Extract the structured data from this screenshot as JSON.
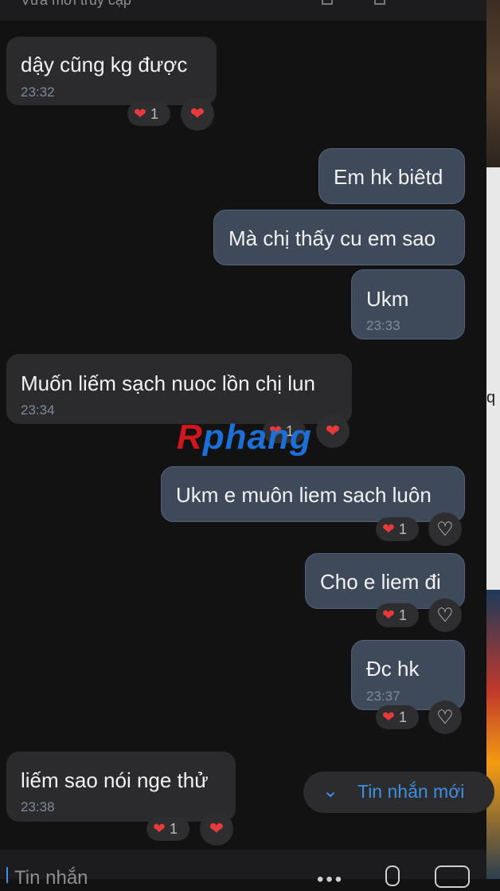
{
  "header": {
    "status": "Vừa mới truy cập"
  },
  "messages": [
    {
      "side": "in",
      "text": "dậy cũng kg được",
      "time": "23:32",
      "reaction_count": "1"
    },
    {
      "side": "out",
      "text": "Em hk biêtd"
    },
    {
      "side": "out",
      "text": "Mà chị thấy cu em sao"
    },
    {
      "side": "out",
      "text": "Ukm",
      "time": "23:33"
    },
    {
      "side": "in",
      "text": "Muốn liếm sạch nuoc lồn chị lun",
      "time": "23:34",
      "reaction_count": "1"
    },
    {
      "side": "out",
      "text": "Ukm e muôn liem sach luôn",
      "reaction_count": "1"
    },
    {
      "side": "out",
      "text": "Cho e liem đi",
      "reaction_count": "1"
    },
    {
      "side": "out",
      "text": "Đc hk",
      "time": "23:37",
      "reaction_count": "1"
    },
    {
      "side": "in",
      "text": "liếm sao nói nge thử",
      "time": "23:38",
      "reaction_count": "1"
    }
  ],
  "new_message_button": {
    "label": "Tin nhắn mới"
  },
  "watermark": {
    "part1": "R",
    "part2": "phang"
  },
  "input": {
    "placeholder": "Tin nhắn"
  },
  "side_strip": {
    "text": "q"
  },
  "colors": {
    "heart": "#e83a3a",
    "accent": "#3d8fe0",
    "out_bubble": "#3e4a5a",
    "in_bubble": "#2b2b2d"
  },
  "icons": {
    "reaction_heart": "heart-icon",
    "reaction_outline": "heart-outline-icon",
    "scroll_down": "double-chevron-down-icon"
  }
}
